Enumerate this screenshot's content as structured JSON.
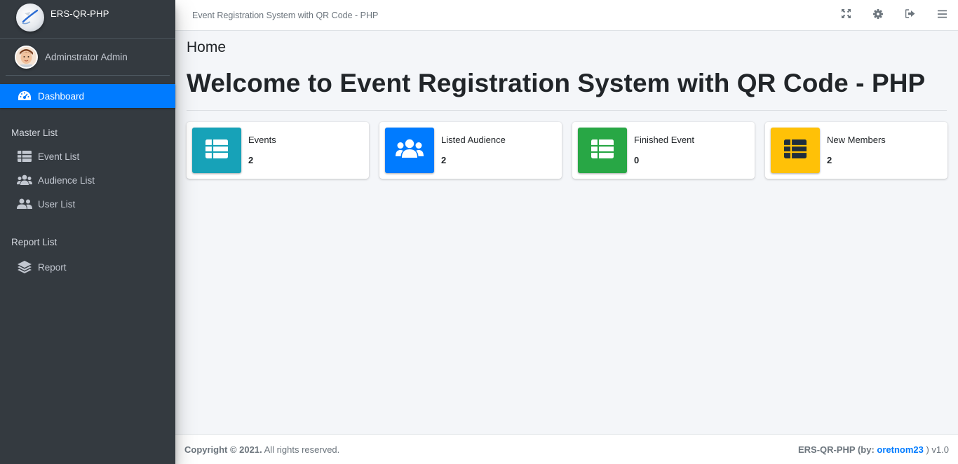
{
  "brand": {
    "name": "ERS-QR-PHP"
  },
  "user": {
    "name": "Adminstrator Admin"
  },
  "sidebar": {
    "dashboard": "Dashboard",
    "sections": [
      {
        "header": "Master List",
        "items": [
          "Event List",
          "Audience List",
          "User List"
        ]
      },
      {
        "header": "Report List",
        "items": [
          "Report"
        ]
      }
    ]
  },
  "topbar": {
    "title": "Event Registration System with QR Code - PHP",
    "icons": [
      "expand-icon",
      "gear-icon",
      "sign-out-icon",
      "menu-icon"
    ]
  },
  "content": {
    "page_title": "Home",
    "welcome": "Welcome to Event Registration System with QR Code - PHP",
    "boxes": [
      {
        "label": "Events",
        "value": "2",
        "color": "#17a2b8",
        "icon": "table-icon"
      },
      {
        "label": "Listed Audience",
        "value": "2",
        "color": "#007bff",
        "icon": "users-icon"
      },
      {
        "label": "Finished Event",
        "value": "0",
        "color": "#28a745",
        "icon": "table-icon"
      },
      {
        "label": "New Members",
        "value": "2",
        "color": "#ffc107",
        "icon": "table-icon"
      }
    ]
  },
  "footer": {
    "copyright_bold": "Copyright © 2021.",
    "copyright_rest": " All rights reserved.",
    "app_prefix": "ERS-QR-PHP (by: ",
    "author": "oretnom23",
    "version_suffix": " ) v1.0"
  },
  "colors": {
    "sidebar": "#343a40",
    "accent": "#007bff",
    "background": "#f4f6f9"
  }
}
